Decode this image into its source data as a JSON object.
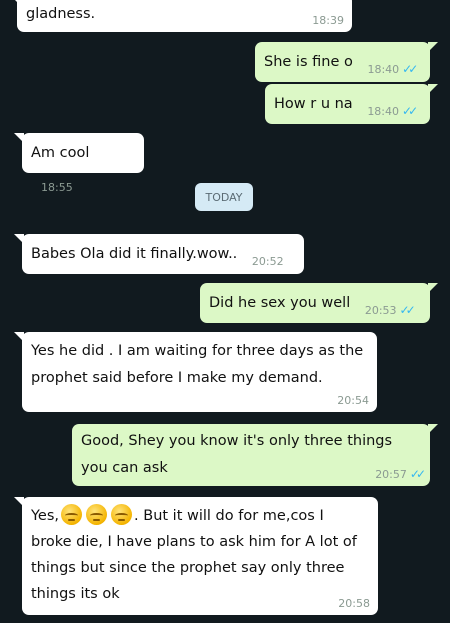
{
  "messages": [
    {
      "text": "gladness.",
      "time": "18:39",
      "direction": "incoming"
    },
    {
      "text": "She is fine o",
      "time": "18:40",
      "direction": "outgoing",
      "status": "read"
    },
    {
      "text": "How r u na",
      "time": "18:40",
      "direction": "outgoing",
      "status": "read"
    },
    {
      "text": "Am cool",
      "time": "18:55",
      "direction": "incoming"
    },
    {
      "text": "Babes Ola did it finally.wow..",
      "time": "20:52",
      "direction": "incoming"
    },
    {
      "text": "Did he sex you well",
      "time": "20:53",
      "direction": "outgoing",
      "status": "read"
    },
    {
      "text": "Yes he did . I am waiting for three days as the prophet said before I make my demand.",
      "time": "20:54",
      "direction": "incoming"
    },
    {
      "text": "Good, Shey you know it's only three things you can ask",
      "time": "20:57",
      "direction": "outgoing",
      "status": "read"
    },
    {
      "text_before": "Yes,",
      "text_after": ". But it will do for me,cos I broke die, I have plans to ask him for A lot of things but since the prophet say only three things its ok",
      "emoji": "pensive-face",
      "emoji_count": 3,
      "time": "20:58",
      "direction": "incoming"
    }
  ],
  "date_divider": "TODAY",
  "read_ticks": "✓✓",
  "colors": {
    "background": "#111a1f",
    "incoming_bubble": "#ffffff",
    "outgoing_bubble": "#dcf8c6",
    "read_tick": "#34b7f1",
    "date_pill": "#d5eaf5"
  }
}
